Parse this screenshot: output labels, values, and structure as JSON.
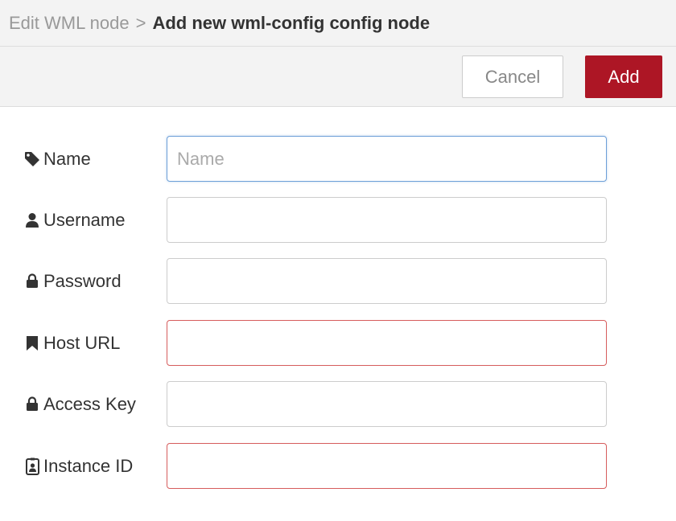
{
  "breadcrumb": {
    "parent": "Edit WML node",
    "separator": ">",
    "current": "Add new wml-config config node"
  },
  "buttons": {
    "cancel_label": "Cancel",
    "add_label": "Add"
  },
  "fields": [
    {
      "label": "Name",
      "icon": "tag-icon",
      "value": "",
      "placeholder": "Name",
      "state": "focused"
    },
    {
      "label": "Username",
      "icon": "user-icon",
      "value": "",
      "placeholder": "",
      "state": "normal"
    },
    {
      "label": "Password",
      "icon": "lock-icon",
      "value": "",
      "placeholder": "",
      "state": "normal"
    },
    {
      "label": "Host URL",
      "icon": "bookmark-icon",
      "value": "",
      "placeholder": "",
      "state": "invalid"
    },
    {
      "label": "Access Key",
      "icon": "lock-icon",
      "value": "",
      "placeholder": "",
      "state": "normal"
    },
    {
      "label": "Instance ID",
      "icon": "id-badge-icon",
      "value": "",
      "placeholder": "",
      "state": "invalid"
    }
  ],
  "colors": {
    "add_button": "#ad1625",
    "invalid_border": "#d65c5c",
    "focus_border": "#6d9fd8"
  }
}
